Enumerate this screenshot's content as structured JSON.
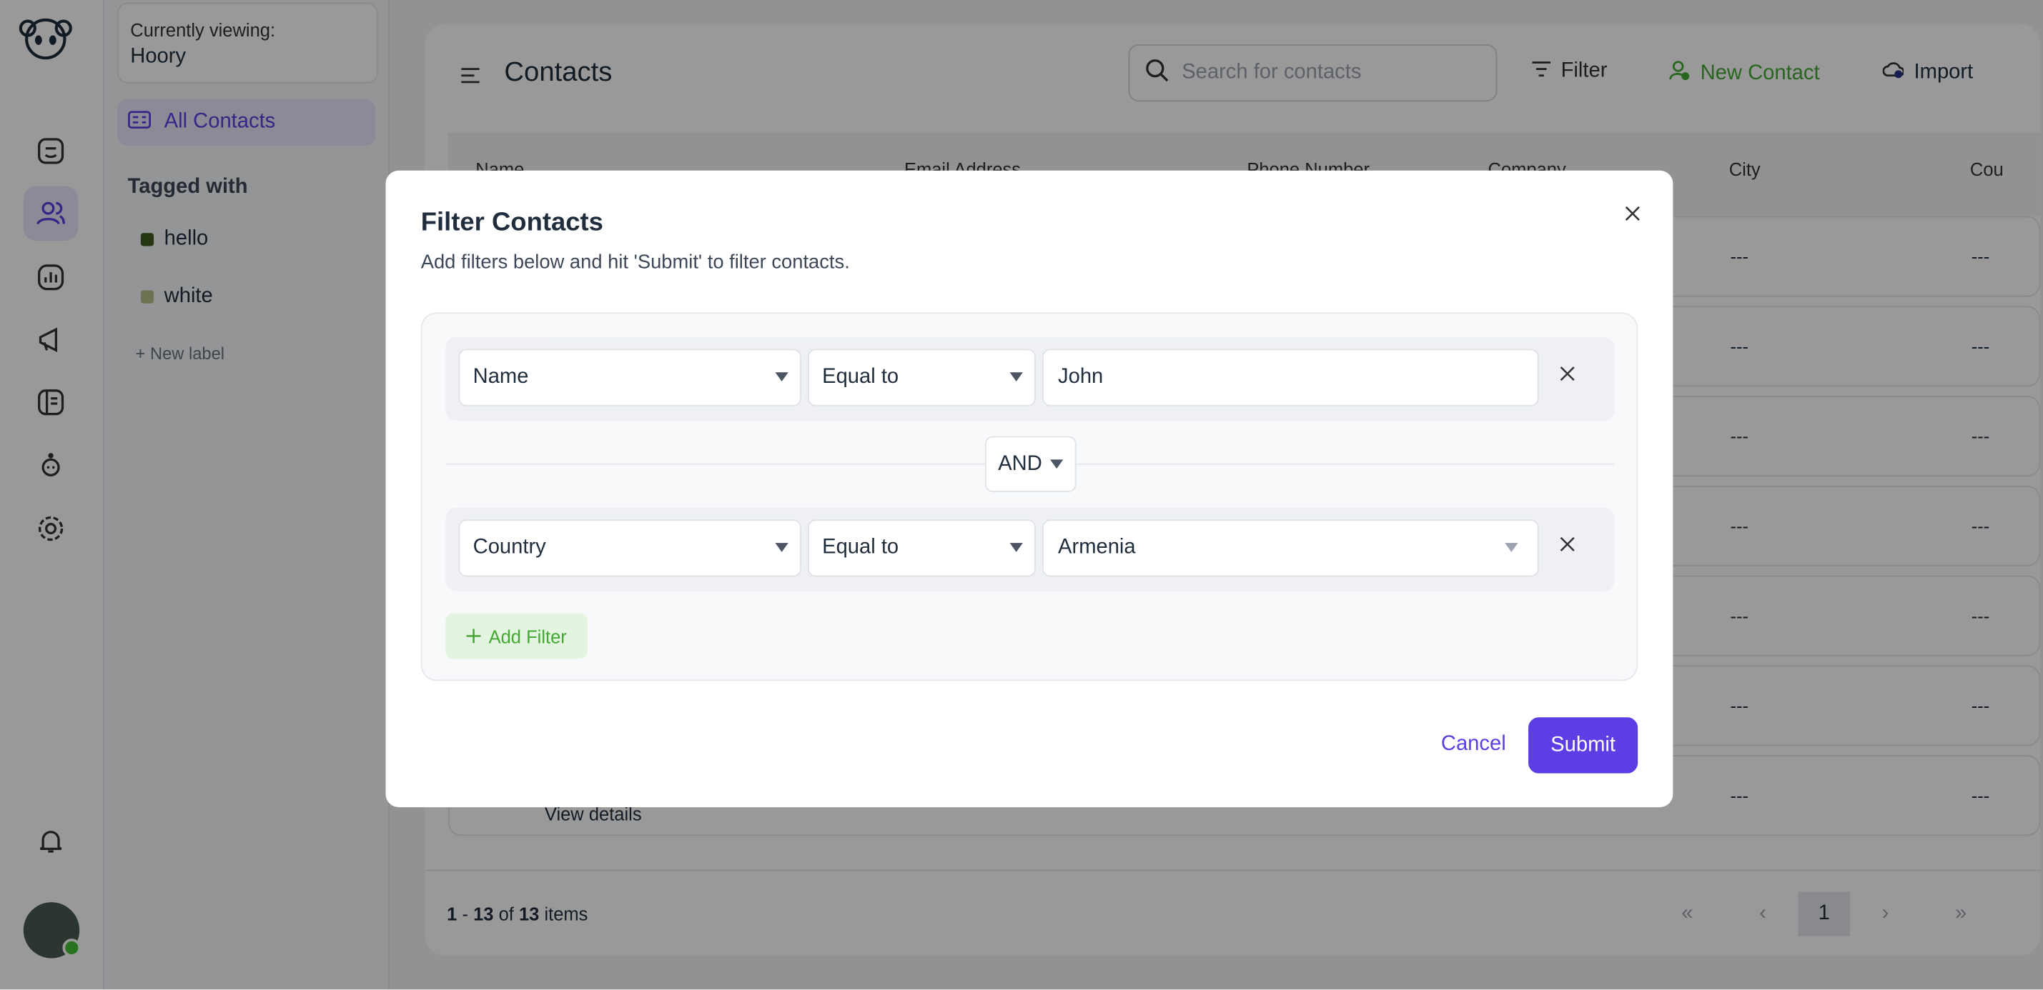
{
  "sidebar": {
    "currently_viewing_label": "Currently viewing:",
    "account": "Hoory",
    "all_contacts": "All Contacts",
    "tagged_with": "Tagged with",
    "tags": [
      {
        "label": "hello",
        "color": "#3f5a1e"
      },
      {
        "label": "white",
        "color": "#b5c08a"
      }
    ],
    "new_label": "+ New label"
  },
  "header": {
    "title": "Contacts",
    "search_placeholder": "Search for contacts",
    "filter": "Filter",
    "new_contact": "New Contact",
    "import": "Import"
  },
  "table": {
    "columns": [
      "Name",
      "Email Address",
      "Phone Number",
      "Company",
      "City",
      "Cou"
    ],
    "rows": [
      {
        "city": "---",
        "country": "---"
      },
      {
        "city": "---",
        "country": "---"
      },
      {
        "city": "---",
        "country": "---"
      },
      {
        "city": "---",
        "country": "---"
      },
      {
        "city": "---",
        "country": "---"
      },
      {
        "city": "---",
        "country": "---"
      },
      {
        "city": "---",
        "country": "---",
        "view": "View details"
      }
    ]
  },
  "footer": {
    "range_start": "1",
    "range_end": "13",
    "total": "13",
    "items_label": "items",
    "sep": "-",
    "of": "of",
    "page": "1"
  },
  "modal": {
    "title": "Filter Contacts",
    "description": "Add filters below and hit 'Submit' to filter contacts.",
    "filters": [
      {
        "attribute": "Name",
        "operator": "Equal to",
        "value": "John"
      },
      {
        "attribute": "Country",
        "operator": "Equal to",
        "value": "Armenia"
      }
    ],
    "joiner": "AND",
    "add_filter": "Add Filter",
    "cancel": "Cancel",
    "submit": "Submit"
  },
  "colors": {
    "accent": "#5d3ee4",
    "green": "#44a833"
  }
}
